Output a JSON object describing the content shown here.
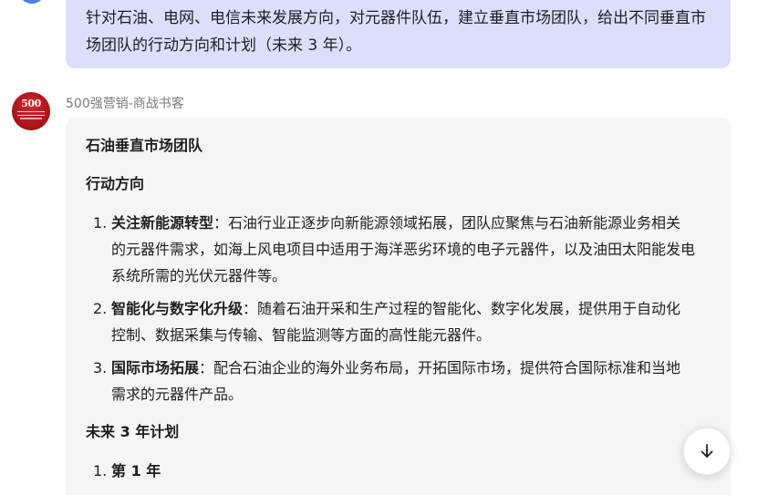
{
  "user_message": {
    "text": "针对石油、电网、电信未来发展方向，对元器件队伍，建立垂直市场团队，给出不同垂直市场团队的行动方向和计划（未来 3 年）。"
  },
  "bot": {
    "name": "500强营销-商战书客",
    "avatar_text": "500"
  },
  "answer": {
    "heading_team": "石油垂直市场团队",
    "heading_direction": "行动方向",
    "items": [
      {
        "num": "1.",
        "bold": "关注新能源转型",
        "text": "：石油行业正逐步向新能源领域拓展，团队应聚焦与石油新能源业务相关的元器件需求，如海上风电项目中适用于海洋恶劣环境的电子元器件，以及油田太阳能发电系统所需的光伏元器件等。"
      },
      {
        "num": "2.",
        "bold": "智能化与数字化升级",
        "text": "：随着石油开采和生产过程的智能化、数字化发展，提供用于自动化控制、数据采集与传输、智能监测等方面的高性能元器件。"
      },
      {
        "num": "3.",
        "bold": "国际市场拓展",
        "text": "：配合石油企业的海外业务布局，开拓国际市场，提供符合国际标准和当地需求的元器件产品。"
      }
    ],
    "heading_plan": "未来 3 年计划",
    "plan_items": [
      {
        "num": "1.",
        "bold": "第 1 年"
      }
    ]
  },
  "colors": {
    "user_bubble": "#dcdffb",
    "answer_card": "#f4f5f7",
    "bot_avatar": "#c81e27"
  },
  "icons": {
    "scroll_button": "arrow-down-icon"
  }
}
